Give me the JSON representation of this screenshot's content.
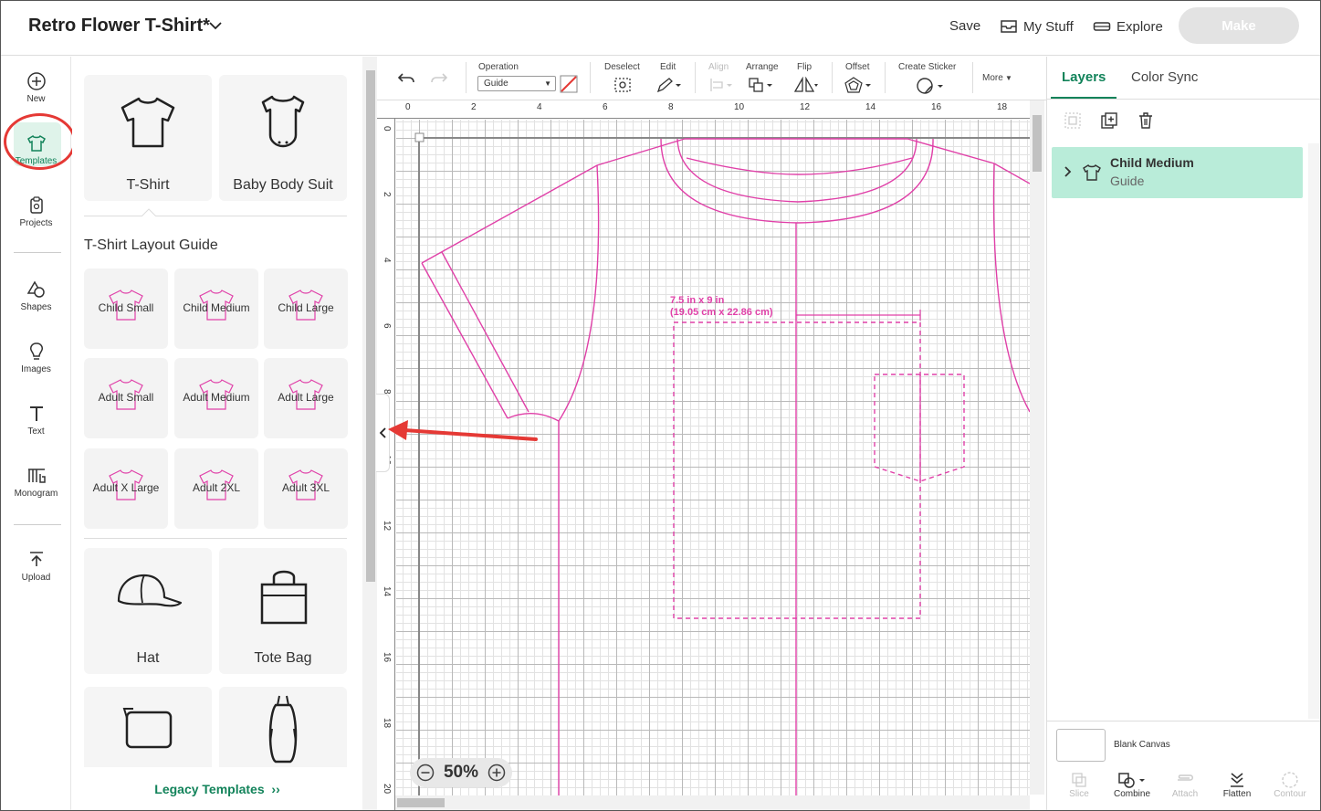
{
  "header": {
    "project_title": "Retro Flower T-Shirt*",
    "save": "Save",
    "my_stuff": "My Stuff",
    "explore": "Explore",
    "make": "Make"
  },
  "leftnav": {
    "items": [
      {
        "label": "New",
        "icon": "plus-circle-icon"
      },
      {
        "label": "Templates",
        "icon": "tshirt-icon"
      },
      {
        "label": "Projects",
        "icon": "projects-icon"
      },
      {
        "label": "Shapes",
        "icon": "shapes-icon"
      },
      {
        "label": "Images",
        "icon": "lightbulb-icon"
      },
      {
        "label": "Text",
        "icon": "text-icon"
      },
      {
        "label": "Monogram",
        "icon": "monogram-icon"
      },
      {
        "label": "Upload",
        "icon": "upload-icon"
      }
    ]
  },
  "templates": {
    "top_cards": [
      "T-Shirt",
      "Baby Body Suit"
    ],
    "section_title": "T-Shirt Layout Guide",
    "sizes": [
      "Child Small",
      "Child Medium",
      "Child Large",
      "Adult Small",
      "Adult Medium",
      "Adult Large",
      "Adult X Large",
      "Adult 2XL",
      "Adult 3XL"
    ],
    "bottom_cards": [
      "Hat",
      "Tote Bag"
    ],
    "legacy": "Legacy Templates"
  },
  "toolbar": {
    "operation_label": "Operation",
    "operation_value": "Guide",
    "deselect": "Deselect",
    "edit": "Edit",
    "align": "Align",
    "arrange": "Arrange",
    "flip": "Flip",
    "offset": "Offset",
    "create_sticker": "Create Sticker",
    "more": "More"
  },
  "rulers": {
    "top": [
      "0",
      "2",
      "4",
      "6",
      "8",
      "10",
      "12",
      "14",
      "16",
      "18"
    ],
    "left": [
      "0",
      "2",
      "4",
      "6",
      "8",
      "10",
      "12",
      "14",
      "16",
      "18",
      "20"
    ]
  },
  "canvas": {
    "dimension_line1": "7.5 in x 9 in",
    "dimension_line2": "(19.05 cm x 22.86 cm)",
    "zoom": "50%"
  },
  "right_panel": {
    "tabs": [
      "Layers",
      "Color Sync"
    ],
    "layer_name": "Child Medium",
    "layer_sub": "Guide",
    "blank_canvas": "Blank Canvas",
    "bottom_tools": [
      {
        "label": "Slice",
        "enabled": false
      },
      {
        "label": "Combine",
        "enabled": true
      },
      {
        "label": "Attach",
        "enabled": false
      },
      {
        "label": "Flatten",
        "enabled": true
      },
      {
        "label": "Contour",
        "enabled": false
      }
    ]
  },
  "colors": {
    "accent": "#12835a",
    "guide_pink": "#e040a8",
    "annotation_red": "#e53935",
    "layer_highlight": "#b9ecd9"
  }
}
